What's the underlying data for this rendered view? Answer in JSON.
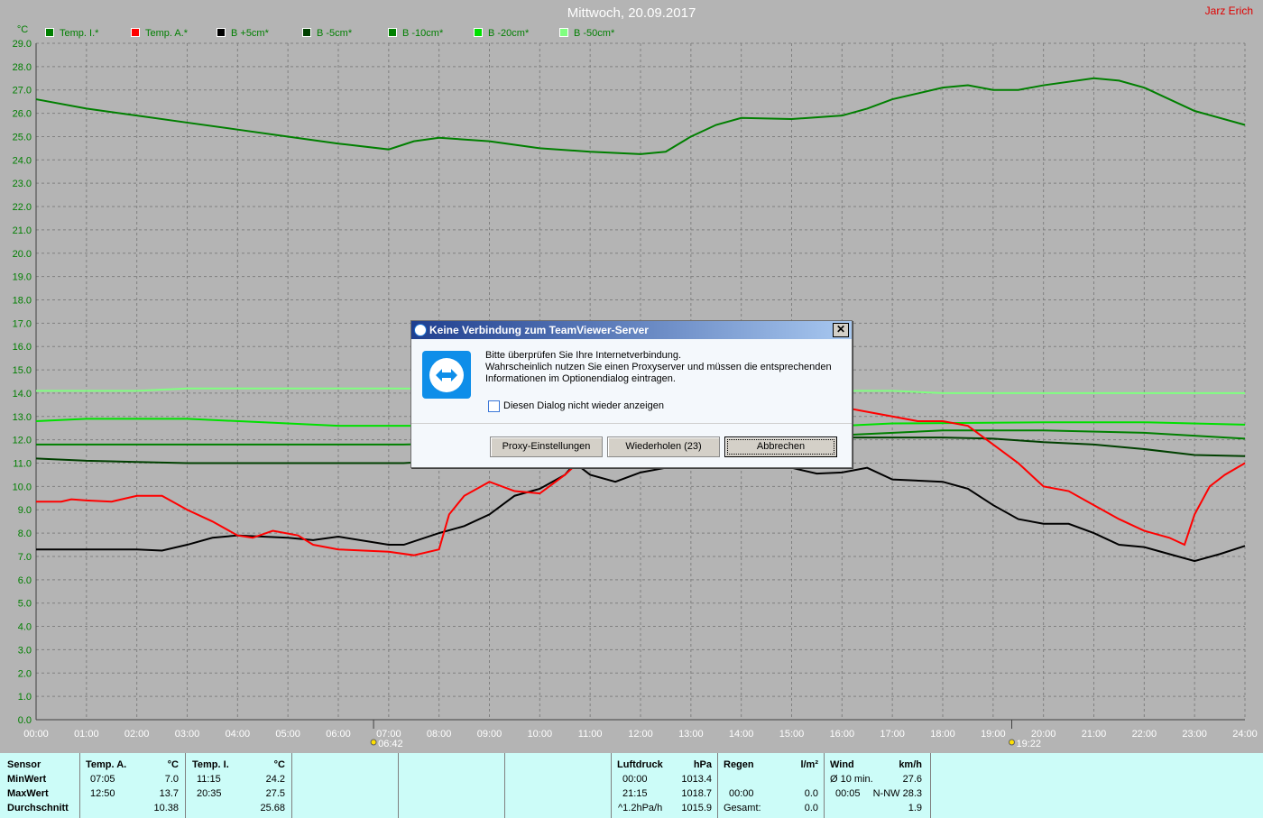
{
  "header": {
    "title": "Mittwoch, 20.09.2017",
    "author": "Jarz Erich",
    "unit": "°C"
  },
  "legend": [
    {
      "label": "Temp. I.*",
      "color": "#007f00"
    },
    {
      "label": "Temp. A.*",
      "color": "#ff0000"
    },
    {
      "label": "B +5cm*",
      "color": "#000000"
    },
    {
      "label": "B -5cm*",
      "color": "#004000"
    },
    {
      "label": "B -10cm*",
      "color": "#008000"
    },
    {
      "label": "B -20cm*",
      "color": "#00e000"
    },
    {
      "label": "B -50cm*",
      "color": "#80ff80"
    }
  ],
  "chart_data": {
    "type": "line",
    "ylim": [
      0,
      29
    ],
    "xlim": [
      0,
      24
    ],
    "grid": true,
    "yticks": [
      "0.0",
      "1.0",
      "2.0",
      "3.0",
      "4.0",
      "5.0",
      "6.0",
      "7.0",
      "8.0",
      "9.0",
      "10.0",
      "11.0",
      "12.0",
      "13.0",
      "14.0",
      "15.0",
      "16.0",
      "17.0",
      "18.0",
      "19.0",
      "20.0",
      "21.0",
      "22.0",
      "23.0",
      "24.0",
      "25.0",
      "26.0",
      "27.0",
      "28.0",
      "29.0"
    ],
    "xticks": [
      "00:00",
      "01:00",
      "02:00",
      "03:00",
      "04:00",
      "05:00",
      "06:00",
      "07:00",
      "08:00",
      "09:00",
      "10:00",
      "11:00",
      "12:00",
      "13:00",
      "14:00",
      "15:00",
      "16:00",
      "17:00",
      "18:00",
      "19:00",
      "20:00",
      "21:00",
      "22:00",
      "23:00",
      "24:00"
    ],
    "markers": [
      {
        "label": "06:42",
        "hour": 6.7,
        "kind": "sunrise"
      },
      {
        "label": "19:22",
        "hour": 19.37,
        "kind": "sunset"
      }
    ],
    "series": [
      {
        "name": "Temp. I.*",
        "color": "#007f00",
        "points": [
          [
            0,
            26.6
          ],
          [
            1,
            26.2
          ],
          [
            2,
            25.9
          ],
          [
            3,
            25.6
          ],
          [
            4,
            25.3
          ],
          [
            5,
            25.0
          ],
          [
            6,
            24.7
          ],
          [
            7,
            24.45
          ],
          [
            7.5,
            24.8
          ],
          [
            8,
            24.95
          ],
          [
            9,
            24.8
          ],
          [
            10,
            24.5
          ],
          [
            11,
            24.35
          ],
          [
            12,
            24.25
          ],
          [
            12.5,
            24.35
          ],
          [
            13,
            25.0
          ],
          [
            13.5,
            25.5
          ],
          [
            14,
            25.8
          ],
          [
            15,
            25.75
          ],
          [
            16,
            25.9
          ],
          [
            16.5,
            26.2
          ],
          [
            17,
            26.6
          ],
          [
            18,
            27.1
          ],
          [
            18.5,
            27.2
          ],
          [
            19,
            27.0
          ],
          [
            19.5,
            27.0
          ],
          [
            20,
            27.2
          ],
          [
            21,
            27.5
          ],
          [
            21.5,
            27.4
          ],
          [
            22,
            27.1
          ],
          [
            23,
            26.1
          ],
          [
            24,
            25.5
          ]
        ]
      },
      {
        "name": "B -50cm*",
        "color": "#80ff80",
        "points": [
          [
            0,
            14.1
          ],
          [
            2,
            14.1
          ],
          [
            3,
            14.2
          ],
          [
            7,
            14.2
          ],
          [
            16,
            14.1
          ],
          [
            17,
            14.1
          ],
          [
            18,
            14.0
          ],
          [
            24,
            14.0
          ]
        ]
      },
      {
        "name": "B -20cm*",
        "color": "#00e000",
        "points": [
          [
            0,
            12.8
          ],
          [
            1,
            12.9
          ],
          [
            3,
            12.9
          ],
          [
            5,
            12.7
          ],
          [
            6,
            12.6
          ],
          [
            7.3,
            12.6
          ],
          [
            16,
            12.6
          ],
          [
            17,
            12.7
          ],
          [
            20,
            12.75
          ],
          [
            22,
            12.75
          ],
          [
            24,
            12.65
          ]
        ]
      },
      {
        "name": "B -10cm*",
        "color": "#008000",
        "points": [
          [
            0,
            11.8
          ],
          [
            7.3,
            11.8
          ],
          [
            16,
            12.2
          ],
          [
            18,
            12.4
          ],
          [
            20,
            12.4
          ],
          [
            22,
            12.3
          ],
          [
            24,
            12.05
          ]
        ]
      },
      {
        "name": "B -5cm*",
        "color": "#004000",
        "points": [
          [
            0,
            11.2
          ],
          [
            1,
            11.1
          ],
          [
            2,
            11.05
          ],
          [
            3,
            11.0
          ],
          [
            7.3,
            11.0
          ],
          [
            16,
            12.1
          ],
          [
            18,
            12.1
          ],
          [
            19,
            12.05
          ],
          [
            20,
            11.9
          ],
          [
            21,
            11.8
          ],
          [
            22,
            11.6
          ],
          [
            23,
            11.35
          ],
          [
            24,
            11.3
          ]
        ]
      },
      {
        "name": "B +5cm*",
        "color": "#000000",
        "points": [
          [
            0,
            7.3
          ],
          [
            2,
            7.3
          ],
          [
            2.5,
            7.25
          ],
          [
            3,
            7.5
          ],
          [
            3.5,
            7.8
          ],
          [
            4,
            7.9
          ],
          [
            5,
            7.8
          ],
          [
            5.5,
            7.7
          ],
          [
            6,
            7.85
          ],
          [
            7,
            7.5
          ],
          [
            7.3,
            7.5
          ],
          [
            8,
            8.0
          ],
          [
            8.5,
            8.3
          ],
          [
            9,
            8.8
          ],
          [
            9.5,
            9.6
          ],
          [
            10,
            9.9
          ],
          [
            10.5,
            10.5
          ],
          [
            10.7,
            11.0
          ],
          [
            11,
            10.5
          ],
          [
            11.5,
            10.2
          ],
          [
            12,
            10.6
          ],
          [
            12.5,
            10.8
          ],
          [
            15,
            10.8
          ],
          [
            15.5,
            10.55
          ],
          [
            16,
            10.6
          ],
          [
            16.5,
            10.8
          ],
          [
            17,
            10.3
          ],
          [
            18,
            10.2
          ],
          [
            18.5,
            9.9
          ],
          [
            19,
            9.2
          ],
          [
            19.5,
            8.6
          ],
          [
            20,
            8.4
          ],
          [
            20.5,
            8.4
          ],
          [
            21,
            8.0
          ],
          [
            21.5,
            7.5
          ],
          [
            22,
            7.4
          ],
          [
            22.5,
            7.1
          ],
          [
            23,
            6.8
          ],
          [
            23.5,
            7.1
          ],
          [
            24,
            7.45
          ]
        ]
      },
      {
        "name": "Temp. A.*",
        "color": "#ff0000",
        "points": [
          [
            0,
            9.35
          ],
          [
            0.5,
            9.35
          ],
          [
            0.7,
            9.45
          ],
          [
            1,
            9.4
          ],
          [
            1.5,
            9.35
          ],
          [
            2,
            9.6
          ],
          [
            2.5,
            9.6
          ],
          [
            3,
            9.0
          ],
          [
            3.5,
            8.5
          ],
          [
            4,
            7.9
          ],
          [
            4.3,
            7.8
          ],
          [
            4.7,
            8.1
          ],
          [
            5.2,
            7.9
          ],
          [
            5.5,
            7.5
          ],
          [
            6,
            7.3
          ],
          [
            7,
            7.2
          ],
          [
            7.5,
            7.05
          ],
          [
            8,
            7.3
          ],
          [
            8.2,
            8.8
          ],
          [
            8.5,
            9.6
          ],
          [
            9,
            10.2
          ],
          [
            9.5,
            9.8
          ],
          [
            10,
            9.7
          ],
          [
            10.5,
            10.5
          ],
          [
            11.5,
            12.5
          ],
          [
            12.83,
            13.7
          ],
          [
            14,
            13.6
          ],
          [
            16,
            13.4
          ],
          [
            16.5,
            13.2
          ],
          [
            17,
            13.0
          ],
          [
            17.5,
            12.8
          ],
          [
            18,
            12.8
          ],
          [
            18.5,
            12.6
          ],
          [
            19,
            11.8
          ],
          [
            19.5,
            11.0
          ],
          [
            20,
            10.0
          ],
          [
            20.5,
            9.8
          ],
          [
            21,
            9.2
          ],
          [
            21.5,
            8.6
          ],
          [
            22,
            8.1
          ],
          [
            22.5,
            7.8
          ],
          [
            22.8,
            7.5
          ],
          [
            23,
            8.8
          ],
          [
            23.3,
            10.0
          ],
          [
            23.6,
            10.5
          ],
          [
            24,
            11.0
          ]
        ]
      }
    ]
  },
  "stats": {
    "sensor": {
      "header": "Sensor",
      "rows": [
        "MinWert",
        "MaxWert",
        "Durchschnitt"
      ]
    },
    "temp_a": {
      "header": "Temp. A.",
      "unit": "°C",
      "min_time": "07:05",
      "min": "7.0",
      "max_time": "12:50",
      "max": "13.7",
      "avg": "10.38"
    },
    "temp_i": {
      "header": "Temp. I.",
      "unit": "°C",
      "min_time": "11:15",
      "min": "24.2",
      "max_time": "20:35",
      "max": "27.5",
      "avg": "25.68"
    },
    "pressure": {
      "header": "Luftdruck",
      "unit": "hPa",
      "min_time": "00:00",
      "min": "1013.4",
      "max_time": "21:15",
      "max": "1018.7",
      "trend": "^1.2hPa/h",
      "avg": "1015.9"
    },
    "rain": {
      "header": "Regen",
      "unit": "l/m²",
      "time": "00:00",
      "value": "0.0",
      "total_label": "Gesamt:",
      "total": "0.0"
    },
    "wind": {
      "header": "Wind",
      "unit": "km/h",
      "avg_label": "Ø 10 min.",
      "avg": "27.6",
      "max_time": "00:05",
      "max": "N-NW 28.3",
      "last": "1.9"
    }
  },
  "dialog": {
    "title": "Keine Verbindung zum TeamViewer-Server",
    "line1": "Bitte überprüfen Sie Ihre Internetverbindung.",
    "line2": "Wahrscheinlich nutzen Sie einen Proxyserver und müssen die entsprechenden",
    "line3": "Informationen im Optionendialog eintragen.",
    "checkbox": "Diesen Dialog nicht wieder anzeigen",
    "btn_proxy": "Proxy-Einstellungen",
    "btn_retry": "Wiederholen (23)",
    "btn_cancel": "Abbrechen",
    "close": "✕"
  }
}
